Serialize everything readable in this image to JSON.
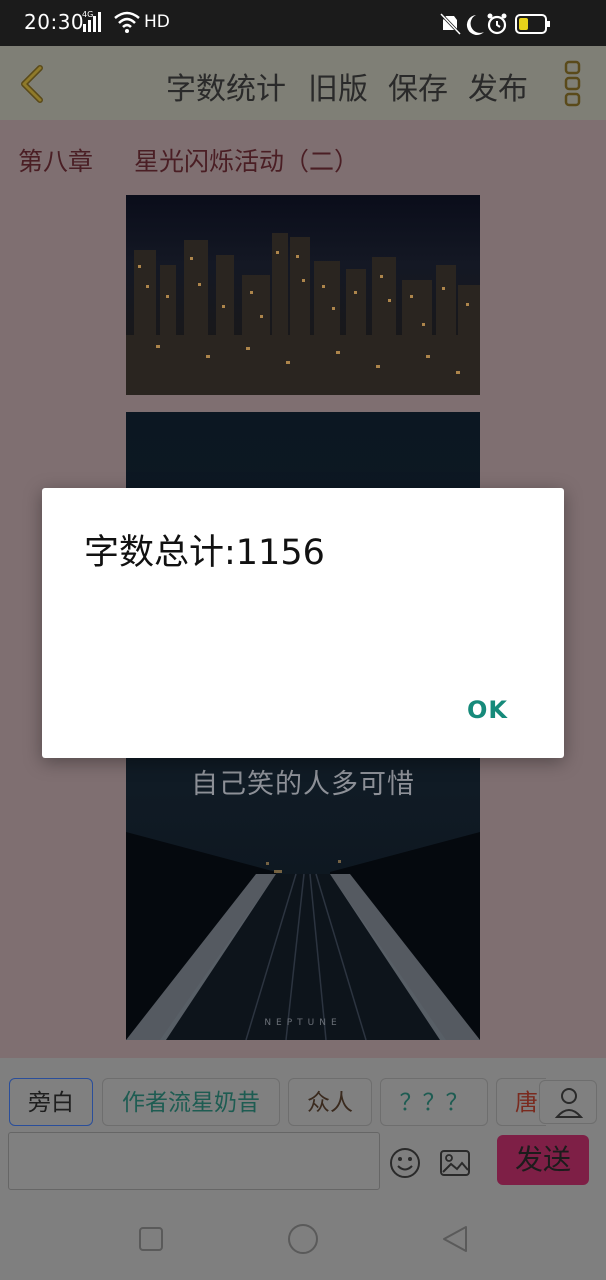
{
  "status_bar": {
    "time": "20:30",
    "network_badge": "4G",
    "hd_label": "HD",
    "icons": [
      "signal-icon",
      "wifi-icon",
      "mute-icon",
      "moon-icon",
      "alarm-icon",
      "battery-icon"
    ]
  },
  "toolbar": {
    "back_icon": "chevron-left-icon",
    "word_count": "字数统计",
    "old_version": "旧版",
    "save": "保存",
    "publish": "发布",
    "more_icon": "more-vertical-icon"
  },
  "content": {
    "chapter_number": "第八章",
    "chapter_title": "星光闪烁活动（二）",
    "image2_text": "自己笑的人多可惜",
    "image2_brand": "NEPTUNE"
  },
  "characters": {
    "chips": [
      "旁白",
      "作者流星奶昔",
      "众人",
      "？？？",
      "唐"
    ],
    "selected_index": 0,
    "chip_colors": [
      "#1e1e1e",
      "#1e5c52",
      "#3a2a1e",
      "#1e5c52",
      "#7a2a1e"
    ]
  },
  "composer": {
    "input_value": "",
    "send_label": "发送",
    "emoji_icon": "smiley-icon",
    "image_icon": "image-icon",
    "person_icon": "person-icon"
  },
  "nav": {
    "icons": [
      "square-icon",
      "circle-icon",
      "triangle-back-icon"
    ]
  },
  "dialog": {
    "message": "字数总计:1156",
    "ok_label": "OK"
  },
  "colors": {
    "accent_send": "#7e1f46",
    "dialog_ok": "#168a7a",
    "chapter_text": "#4a1e24"
  }
}
